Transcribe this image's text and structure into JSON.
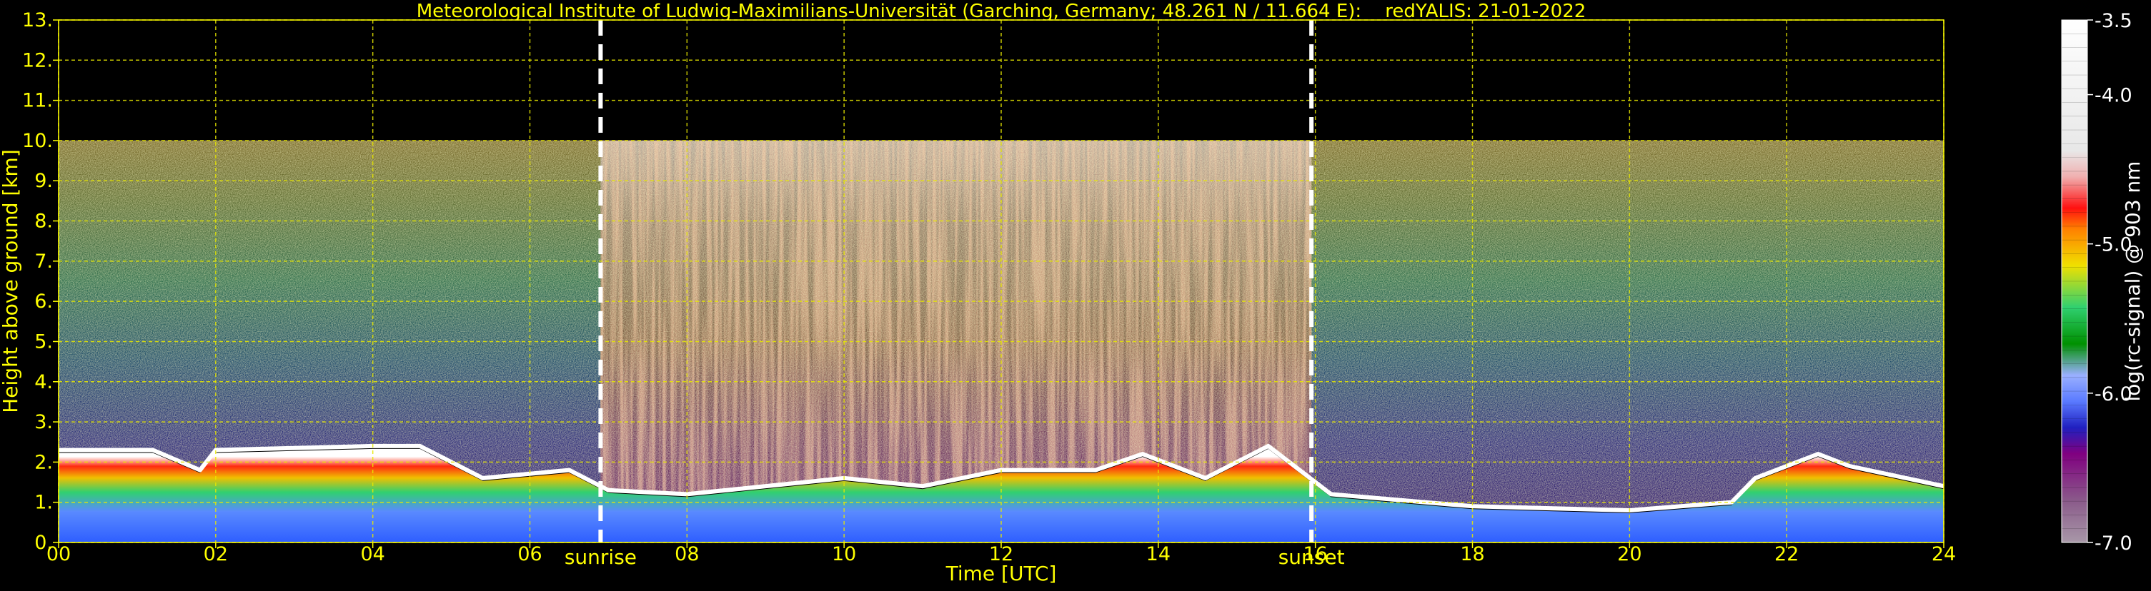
{
  "chart_data": {
    "type": "heatmap",
    "title": "Meteorological Institute of Ludwig-Maximilians-Universität (Garching, Germany; 48.261 N / 11.664 E):    redYALIS: 21-01-2022",
    "xlabel": "Time [UTC]",
    "ylabel": "Height above ground [km]",
    "xlim": [
      0,
      24
    ],
    "ylim": [
      0,
      13
    ],
    "x_ticks": [
      "00",
      "02",
      "04",
      "06",
      "08",
      "10",
      "12",
      "14",
      "16",
      "18",
      "20",
      "22",
      "24"
    ],
    "y_ticks": [
      "0.",
      "1.",
      "2.",
      "3.",
      "4.",
      "5.",
      "6.",
      "7.",
      "8.",
      "9.",
      "10.",
      "11.",
      "12.",
      "13."
    ],
    "grid": true,
    "grid_color": "#e8e800",
    "text_color": "#ffff00",
    "background": "#000000",
    "data_top_km": 10,
    "events": [
      {
        "label": "sunrise",
        "time": 6.9
      },
      {
        "label": "sunset",
        "time": 15.95
      }
    ],
    "colorbar": {
      "label": "log(rc-signal) @ 903 nm",
      "range": [
        -7.0,
        -3.5
      ],
      "tick_labels": [
        "-3.5",
        "-4.0",
        "-5.0",
        "-6.0",
        "-7.0"
      ],
      "tick_values": [
        -3.5,
        -4.0,
        -5.0,
        -6.0,
        -7.0
      ]
    },
    "boundary_layer_top_km": [
      [
        0.0,
        2.3
      ],
      [
        1.2,
        2.3
      ],
      [
        1.8,
        1.8
      ],
      [
        2.0,
        2.3
      ],
      [
        4.0,
        2.4
      ],
      [
        4.6,
        2.4
      ],
      [
        5.4,
        1.6
      ],
      [
        6.5,
        1.8
      ],
      [
        7.0,
        1.3
      ],
      [
        8.0,
        1.2
      ],
      [
        10.0,
        1.6
      ],
      [
        11.0,
        1.4
      ],
      [
        12.0,
        1.8
      ],
      [
        13.2,
        1.8
      ],
      [
        13.8,
        2.2
      ],
      [
        14.6,
        1.6
      ],
      [
        15.4,
        2.4
      ],
      [
        16.2,
        1.2
      ],
      [
        18.0,
        0.9
      ],
      [
        20.0,
        0.8
      ],
      [
        21.3,
        1.0
      ],
      [
        21.6,
        1.6
      ],
      [
        22.4,
        2.2
      ],
      [
        22.8,
        1.9
      ],
      [
        24.0,
        1.4
      ]
    ]
  }
}
